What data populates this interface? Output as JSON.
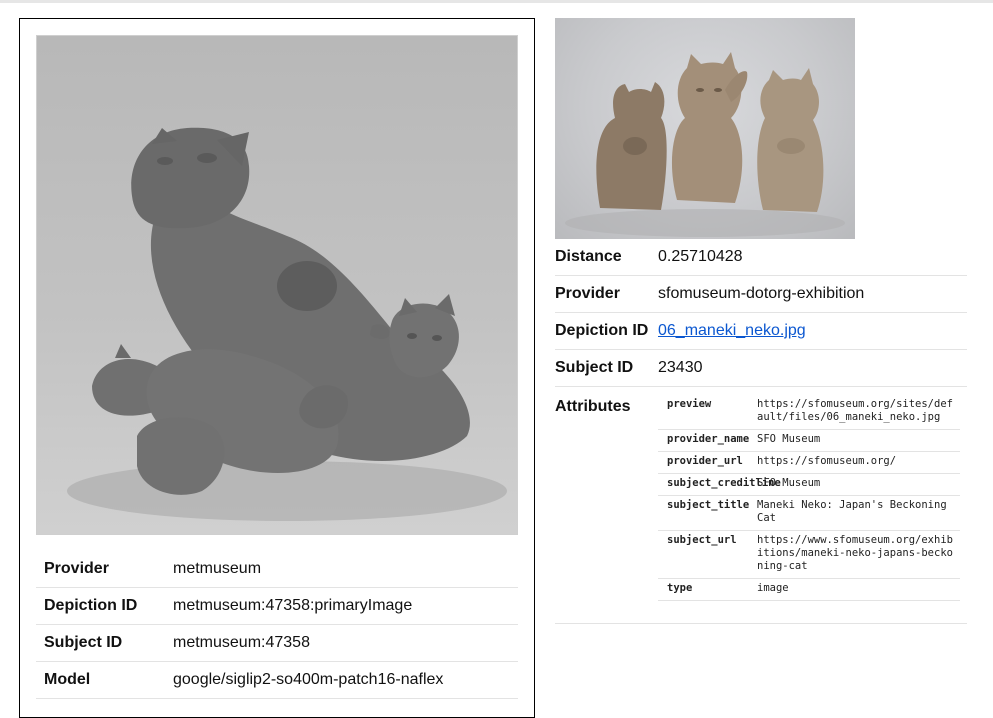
{
  "query": {
    "image_icon": "cat-family-sculpture-photo",
    "rows": [
      {
        "key": "Provider",
        "value": "metmuseum"
      },
      {
        "key": "Depiction ID",
        "value": "metmuseum:47358:primaryImage"
      },
      {
        "key": "Subject ID",
        "value": "metmuseum:47358"
      },
      {
        "key": "Model",
        "value": "google/siglip2-so400m-patch16-naflex"
      }
    ]
  },
  "match": {
    "image_icon": "three-maneki-neko-photo",
    "distance_label": "Distance",
    "distance": "0.25710428",
    "provider_label": "Provider",
    "provider": "sfomuseum-dotorg-exhibition",
    "depiction_label": "Depiction ID",
    "depiction_id": "06_maneki_neko.jpg",
    "subject_label": "Subject ID",
    "subject_id": "23430",
    "attributes_label": "Attributes",
    "attributes": [
      {
        "key": "preview",
        "value": "https://sfomuseum.org/sites/default/files/06_maneki_neko.jpg"
      },
      {
        "key": "provider_name",
        "value": "SFO Museum"
      },
      {
        "key": "provider_url",
        "value": "https://sfomuseum.org/"
      },
      {
        "key": "subject_creditline",
        "value": "SFO Museum"
      },
      {
        "key": "subject_title",
        "value": "Maneki Neko: Japan's Beckoning Cat"
      },
      {
        "key": "subject_url",
        "value": "https://www.sfomuseum.org/exhibitions/maneki-neko-japans-beckoning-cat"
      },
      {
        "key": "type",
        "value": "image"
      }
    ]
  }
}
